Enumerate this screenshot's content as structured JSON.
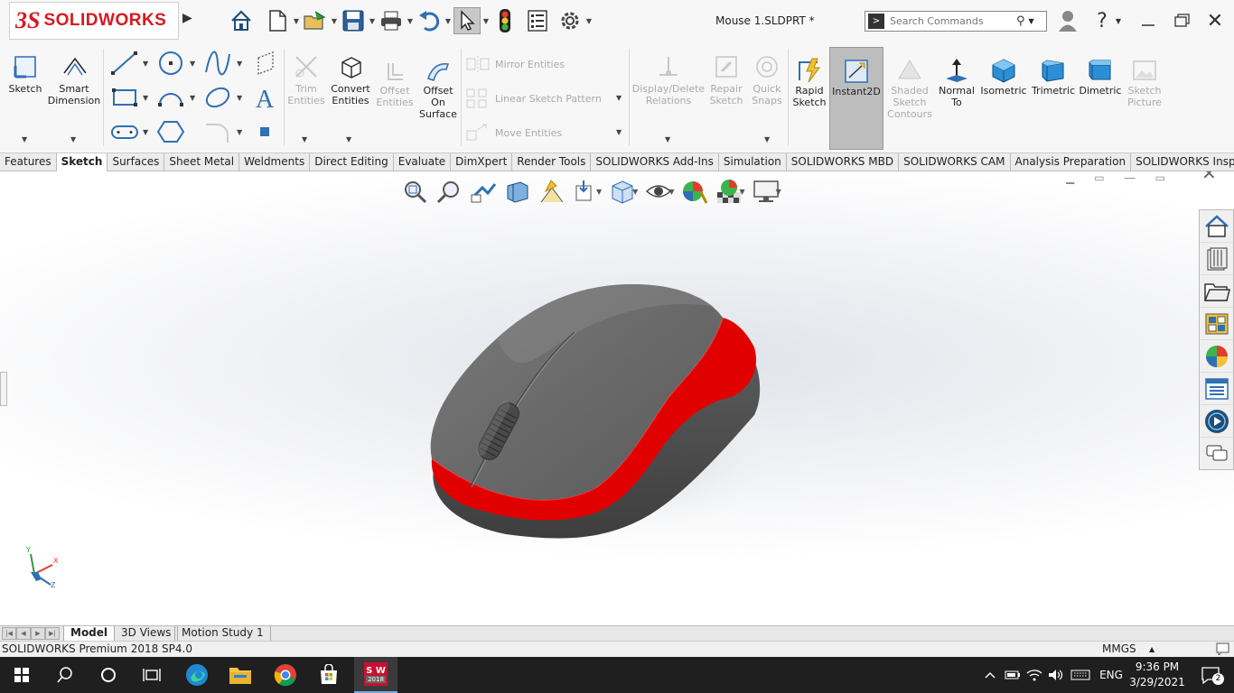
{
  "app": {
    "brand_prefix": "3S",
    "brand": "SOLIDWORKS",
    "document_title": "Mouse 1.SLDPRT *"
  },
  "search": {
    "placeholder": "Search Commands"
  },
  "ribbon": {
    "sketch": "Sketch",
    "smart_dimension": "Smart\nDimension",
    "trim_entities": "Trim\nEntities",
    "convert_entities": "Convert\nEntities",
    "offset_entities": "Offset\nEntities",
    "offset_on_surface": "Offset\nOn\nSurface",
    "mirror_entities": "Mirror Entities",
    "linear_sketch_pattern": "Linear Sketch Pattern",
    "move_entities": "Move Entities",
    "display_delete_relations": "Display/Delete\nRelations",
    "repair_sketch": "Repair\nSketch",
    "quick_snaps": "Quick\nSnaps",
    "rapid_sketch": "Rapid\nSketch",
    "instant2d": "Instant2D",
    "shaded_sketch_contours": "Shaded\nSketch\nContours",
    "normal_to": "Normal\nTo",
    "isometric": "Isometric",
    "trimetric": "Trimetric",
    "dimetric": "Dimetric",
    "sketch_picture": "Sketch\nPicture"
  },
  "tabs": [
    "Features",
    "Sketch",
    "Surfaces",
    "Sheet Metal",
    "Weldments",
    "Direct Editing",
    "Evaluate",
    "DimXpert",
    "Render Tools",
    "SOLIDWORKS Add-Ins",
    "Simulation",
    "SOLIDWORKS MBD",
    "SOLIDWORKS CAM",
    "Analysis Preparation",
    "SOLIDWORKS Inspection"
  ],
  "active_tab": "Sketch",
  "bottom_tabs": [
    "Model",
    "3D Views",
    "Motion Study 1"
  ],
  "status": {
    "product": "SOLIDWORKS Premium 2018 SP4.0",
    "units": "MMGS"
  },
  "triad": {
    "x": "X",
    "y": "Y",
    "z": "Z"
  },
  "taskbar": {
    "sw_badge": "S W",
    "sw_year": "2018",
    "language": "ENG",
    "time": "9:36 PM",
    "date": "3/29/2021",
    "notifications": "2"
  },
  "colors": {
    "brand_red": "#d71920",
    "mouse_body": "#6a6a6a",
    "mouse_accent": "#e00000",
    "taskbar": "#1f1f1f"
  },
  "icons": {
    "titlebar": [
      "home-icon",
      "new-document-icon",
      "open-icon",
      "save-icon",
      "print-icon",
      "undo-icon",
      "select-icon",
      "rebuild-icon",
      "file-properties-icon",
      "options-icon"
    ],
    "heads_up": [
      "zoom-to-fit-icon",
      "zoom-to-area-icon",
      "previous-view-icon",
      "section-view-icon",
      "dynamic-annotation-icon",
      "view-orientation-icon",
      "display-style-icon",
      "hide-show-icon",
      "edit-appearance-icon",
      "apply-scene-icon",
      "view-settings-icon"
    ],
    "task_pane": [
      "solidworks-resources-icon",
      "design-library-icon",
      "file-explorer-icon",
      "view-palette-icon",
      "appearances-icon",
      "custom-properties-icon",
      "solidworks-forum-icon",
      "feedback-icon"
    ]
  }
}
